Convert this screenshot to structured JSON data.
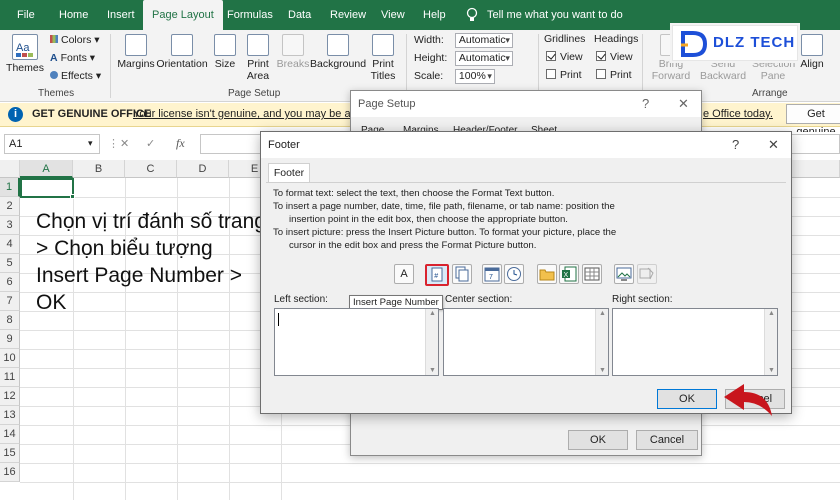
{
  "ribbon_tabs": [
    "File",
    "Home",
    "Insert",
    "Page Layout",
    "Formulas",
    "Data",
    "Review",
    "View",
    "Help"
  ],
  "tell_me": "Tell me what you want to do",
  "themes_group": {
    "themes_label": "Themes",
    "colors_label": "Colors",
    "fonts_label": "Fonts",
    "effects_label": "Effects",
    "group_label": "Themes"
  },
  "page_setup_group": {
    "margins": "Margins",
    "orientation": "Orientation",
    "size": "Size",
    "print_area": "Print Area",
    "breaks": "Breaks",
    "background": "Background",
    "print_titles": "Print Titles",
    "group_label": "Page Setup"
  },
  "scale_group": {
    "width_label": "Width:",
    "width_value": "Automatic",
    "height_label": "Height:",
    "height_value": "Automatic",
    "scale_label": "Scale:",
    "scale_value": "100%"
  },
  "sheet_options": {
    "gridlines": "Gridlines",
    "headings": "Headings",
    "view": "View",
    "print": "Print"
  },
  "arrange": {
    "bring_forward": "Bring Forward",
    "send_backward": "Send Backward",
    "selection_pane": "Selection Pane",
    "align": "Align",
    "group_label": "Arrange"
  },
  "logo_text": "DLZ TECH",
  "message_bar": {
    "title": "GET GENUINE OFFICE",
    "text": "Your license isn't genuine, and you may be a victim",
    "text_right": "e Office today.",
    "button": "Get genuine"
  },
  "formula_bar": {
    "name_box": "A1",
    "fx": "fx"
  },
  "columns": [
    "A",
    "B",
    "C",
    "D",
    "E"
  ],
  "rows": [
    "1",
    "2",
    "3",
    "4",
    "5",
    "6",
    "7",
    "8",
    "9",
    "10",
    "11",
    "12",
    "13",
    "14",
    "15",
    "16"
  ],
  "caption": "Chọn vị trí đánh số trang > Chọn biểu tượng Insert Page Number > OK",
  "page_setup_dialog": {
    "title": "Page Setup",
    "tabs": [
      "Page",
      "Margins",
      "Header/Footer",
      "Sheet"
    ],
    "ok": "OK",
    "cancel": "Cancel"
  },
  "footer_dialog": {
    "title": "Footer",
    "help": "?",
    "close": "✕",
    "tab": "Footer",
    "instructions": [
      "To format text:  select the text, then choose the Format Text button.",
      "To insert a page number, date, time, file path, filename, or tab name:  position the",
      "insertion point in the edit box, then choose the appropriate button.",
      "To insert picture: press the Insert Picture button.  To format your picture, place the",
      "cursor in the edit box and press the Format Picture button."
    ],
    "tooltip": "Insert Page Number",
    "left_section": "Left section:",
    "center_section": "Center section:",
    "right_section": "Right section:",
    "ok": "OK",
    "cancel": "Cancel"
  },
  "colors": {
    "excel_green": "#217346",
    "highlight_red": "#d9232e",
    "arrow_red": "#c8161d",
    "logo_blue": "#1d4fd8"
  }
}
